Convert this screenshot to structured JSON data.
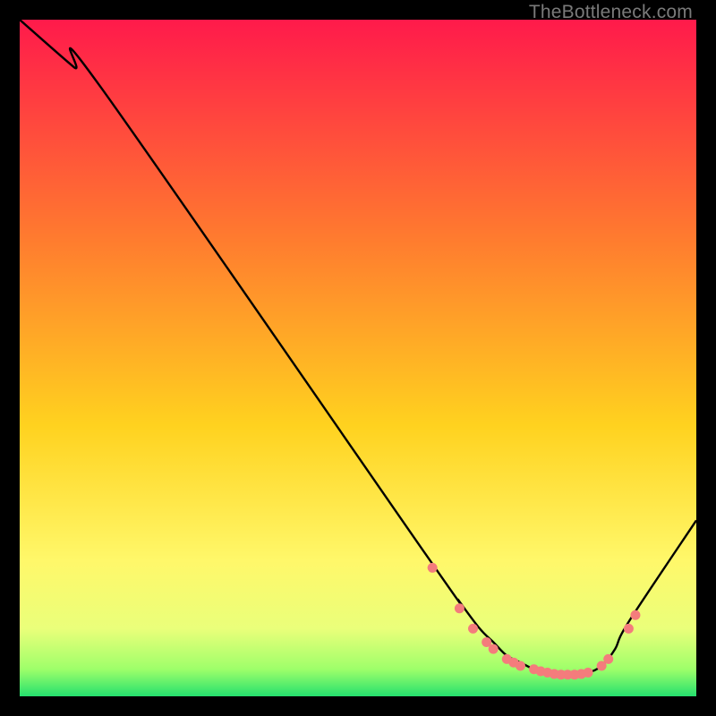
{
  "watermark": {
    "text": "TheBottleneck.com"
  },
  "colors": {
    "gradient_top": "#ff1a4b",
    "gradient_mid1": "#ff7a2f",
    "gradient_mid2": "#ffd21f",
    "gradient_mid3": "#fff86a",
    "gradient_mid4": "#eaff7a",
    "gradient_bot1": "#9eff6a",
    "gradient_bot2": "#25e06e",
    "curve": "#000000",
    "dot": "#f47c7c"
  },
  "chart_data": {
    "type": "line",
    "title": "",
    "xlabel": "",
    "ylabel": "",
    "xlim": [
      0,
      100
    ],
    "ylim": [
      0,
      100
    ],
    "series": [
      {
        "name": "curve",
        "x": [
          0,
          8,
          12,
          60,
          65,
          68,
          70,
          72,
          74,
          76,
          78,
          80,
          82,
          84,
          86,
          88,
          90,
          100
        ],
        "y": [
          100,
          93,
          90,
          21,
          14,
          10,
          8,
          6,
          5,
          4,
          3.5,
          3,
          3.2,
          3.5,
          4.5,
          7,
          11,
          26
        ]
      }
    ],
    "markers": {
      "name": "dots",
      "x": [
        61,
        65,
        67,
        69,
        70,
        72,
        73,
        74,
        76,
        77,
        78,
        79,
        80,
        81,
        82,
        83,
        84,
        86,
        87,
        90,
        91
      ],
      "y": [
        19,
        13,
        10,
        8,
        7,
        5.5,
        5,
        4.5,
        4,
        3.7,
        3.5,
        3.3,
        3.2,
        3.2,
        3.2,
        3.3,
        3.5,
        4.5,
        5.5,
        10,
        12
      ]
    }
  }
}
